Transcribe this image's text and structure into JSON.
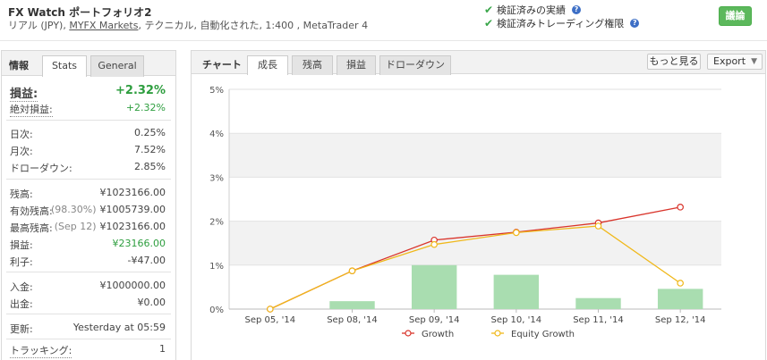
{
  "header": {
    "title": "FX Watch ポートフォリオ2",
    "subtitle_prefix": "リアル (JPY), ",
    "broker": "MYFX Markets",
    "subtitle_suffix": ", テクニカル, 自動化された, 1:400 , MetaTrader 4",
    "verify_track": "検証済みの実績",
    "verify_trading": "検証済みトレーディング権限",
    "discuss_label": "議論"
  },
  "left": {
    "heading": "情報",
    "tabs": [
      "Stats",
      "General"
    ],
    "stats": {
      "gain_label": "損益:",
      "gain_value": "+2.32%",
      "abs_gain_label": "絶対損益:",
      "abs_gain_value": "+2.32%",
      "daily_label": "日次:",
      "daily_value": "0.25%",
      "monthly_label": "月次:",
      "monthly_value": "7.52%",
      "drawdown_label": "ドローダウン:",
      "drawdown_value": "2.85%",
      "balance_label": "残高:",
      "balance_value": "¥1023166.00",
      "equity_label": "有効残高:",
      "equity_note": "(98.30%)",
      "equity_value": "¥1005739.00",
      "highest_label": "最高残高:",
      "highest_note": "(Sep 12)",
      "highest_value": "¥1023166.00",
      "profit_label": "損益:",
      "profit_value": "¥23166.00",
      "interest_label": "利子:",
      "interest_value": "-¥47.00",
      "deposits_label": "入金:",
      "deposits_value": "¥1000000.00",
      "withdrawals_label": "出金:",
      "withdrawals_value": "¥0.00",
      "updated_label": "更新:",
      "updated_value": "Yesterday at 05:59",
      "tracking_label": "トラッキング:",
      "tracking_value": "1"
    }
  },
  "right": {
    "heading": "チャート",
    "tabs": [
      "成長",
      "残高",
      "損益",
      "ドローダウン"
    ],
    "more_label": "もっと見る",
    "export_label": "Export"
  },
  "colors": {
    "growth": "#d9342b",
    "equity": "#f0b81a",
    "bars": "#a9ddb0",
    "green_text": "#2e9e3f"
  },
  "chart_data": {
    "type": "line",
    "categories": [
      "Sep 05, '14",
      "Sep 08, '14",
      "Sep 09, '14",
      "Sep 10, '14",
      "Sep 11, '14",
      "Sep 12, '14"
    ],
    "series": [
      {
        "name": "Growth",
        "type": "line",
        "values": [
          0.0,
          0.87,
          1.57,
          1.75,
          1.96,
          2.32
        ]
      },
      {
        "name": "Equity Growth",
        "type": "line",
        "values": [
          0.0,
          0.87,
          1.47,
          1.74,
          1.89,
          0.59
        ]
      },
      {
        "type": "bar",
        "values": [
          0.0,
          0.18,
          1.0,
          0.78,
          0.25,
          0.46
        ]
      }
    ],
    "ytick_labels": [
      "0%",
      "1%",
      "2%",
      "3%",
      "4%",
      "5%"
    ],
    "ylim": [
      0,
      5
    ],
    "legend_position": "bottom",
    "grid": "alternating horizontal bands"
  }
}
